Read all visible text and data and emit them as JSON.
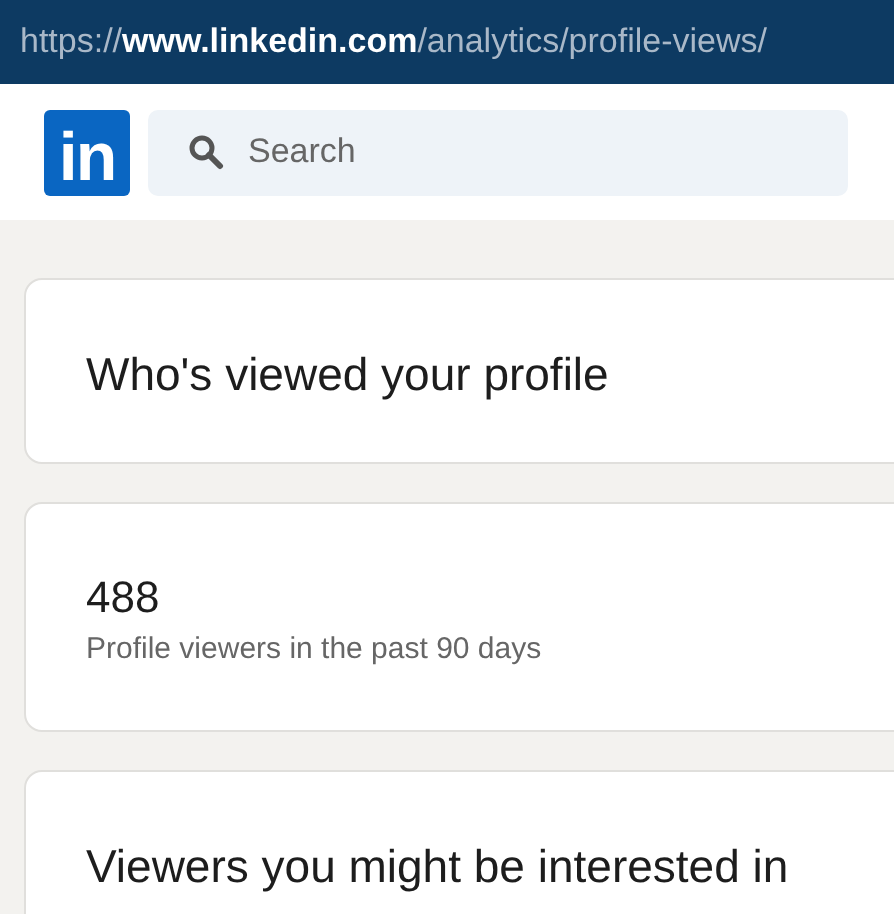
{
  "address_bar": {
    "url": "https://**www.linkedin.com**/analytics/profile-views/"
  },
  "header": {
    "logo": "in",
    "search": {
      "placeholder": "Search"
    }
  },
  "cards": [
    {
      "kind": "heading",
      "title": "Who's viewed your profile"
    },
    {
      "kind": "stat",
      "value": "488",
      "caption": "Profile viewers in the past 90 days"
    },
    {
      "kind": "heading",
      "title": "Viewers you might be interested in"
    }
  ]
}
